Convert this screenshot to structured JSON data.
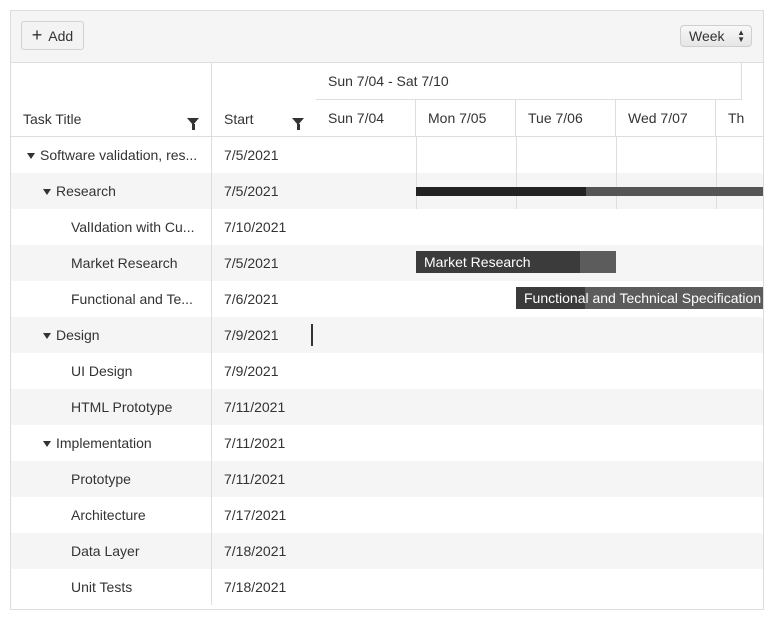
{
  "toolbar": {
    "add_label": "Add",
    "add_icon": "plus-icon",
    "view_value": "Week"
  },
  "columns": {
    "title": "Task Title",
    "start": "Start"
  },
  "timeline": {
    "week_label": "Sun 7/04 - Sat 7/10",
    "days": [
      "Sun 7/04",
      "Mon 7/05",
      "Tue 7/06",
      "Wed 7/07",
      "Th"
    ]
  },
  "tasks": [
    {
      "title": "Software validation, res...",
      "start": "7/5/2021",
      "level": 0,
      "expanded": true
    },
    {
      "title": "Research",
      "start": "7/5/2021",
      "level": 1,
      "expanded": true
    },
    {
      "title": "ValIdation with Cu...",
      "start": "7/10/2021",
      "level": 2
    },
    {
      "title": "Market Research",
      "start": "7/5/2021",
      "level": 2
    },
    {
      "title": "Functional and Te...",
      "start": "7/6/2021",
      "level": 2
    },
    {
      "title": "Design",
      "start": "7/9/2021",
      "level": 1,
      "expanded": true
    },
    {
      "title": "UI Design",
      "start": "7/9/2021",
      "level": 2
    },
    {
      "title": "HTML Prototype",
      "start": "7/11/2021",
      "level": 2
    },
    {
      "title": "Implementation",
      "start": "7/11/2021",
      "level": 1,
      "expanded": true
    },
    {
      "title": "Prototype",
      "start": "7/11/2021",
      "level": 2
    },
    {
      "title": "Architecture",
      "start": "7/17/2021",
      "level": 2
    },
    {
      "title": "Data Layer",
      "start": "7/18/2021",
      "level": 2
    },
    {
      "title": "Unit Tests",
      "start": "7/18/2021",
      "level": 2
    }
  ],
  "bars": {
    "research_summary": {
      "progress": 0.49
    },
    "market_research": {
      "label": "Market Research",
      "progress": 0.82
    },
    "functional_spec": {
      "label": "Functional and Technical Specification",
      "progress": 0.28
    }
  }
}
